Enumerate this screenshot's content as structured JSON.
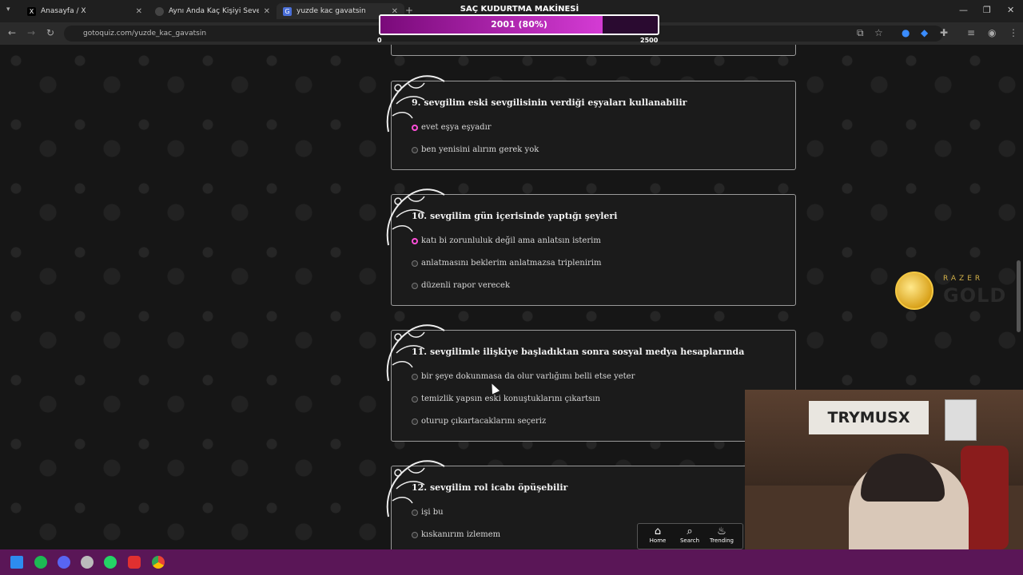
{
  "browser": {
    "tabs": [
      {
        "label": "Anasayfa / X",
        "icon": "x-logo-icon"
      },
      {
        "label": "Aynı Anda Kaç Kişiyi Sevebilirsin",
        "icon": "quiz-icon"
      },
      {
        "label": "yuzde kac gavatsin",
        "icon": "gotoquiz-icon"
      }
    ],
    "url": "gotoquiz.com/yuzde_kac_gavatsin"
  },
  "overlay": {
    "title": "SAÇ KUDURTMA MAKİNESİ",
    "meter_text": "2001 (80%)",
    "meter_fraction": 0.8,
    "min": "0",
    "max": "2500"
  },
  "razer": {
    "top": "RAZER",
    "gold": "GOLD"
  },
  "webcam": {
    "sign": "TRYMUSX"
  },
  "questions": [
    {
      "title": "9. sevgilim eski sevgilisinin verdiği eşyaları kullanabilir",
      "options": [
        {
          "label": "evet eşya eşyadır",
          "selected": true
        },
        {
          "label": "ben yenisini alırım gerek yok",
          "selected": false
        }
      ]
    },
    {
      "title": "10. sevgilim gün içerisinde yaptığı şeyleri",
      "options": [
        {
          "label": "katı bi zorunluluk değil ama anlatsın isterim",
          "selected": true
        },
        {
          "label": "anlatmasını beklerim anlatmazsa triplenirim",
          "selected": false
        },
        {
          "label": "düzenli rapor verecek",
          "selected": false
        }
      ]
    },
    {
      "title": "11. sevgilimle ilişkiye başladıktan sonra sosyal medya hesaplarında",
      "options": [
        {
          "label": "bir şeye dokunmasa da olur varlığımı belli etse yeter",
          "selected": false
        },
        {
          "label": "temizlik yapsın eski konuştuklarını çıkartsın",
          "selected": false
        },
        {
          "label": "oturup çıkartacaklarını seçeriz",
          "selected": false
        }
      ]
    },
    {
      "title": "12. sevgilim rol icabı öpüşebilir",
      "options": [
        {
          "label": "işi bu",
          "selected": false
        },
        {
          "label": "kıskanırım izlemem",
          "selected": false
        }
      ]
    }
  ],
  "bottom_nav": [
    {
      "label": "Home",
      "icon": "home-icon"
    },
    {
      "label": "Search",
      "icon": "search-icon"
    },
    {
      "label": "Trending",
      "icon": "flame-icon"
    }
  ],
  "colors": {
    "accent": "#ff4fd8",
    "taskbar": "#5a1657"
  }
}
